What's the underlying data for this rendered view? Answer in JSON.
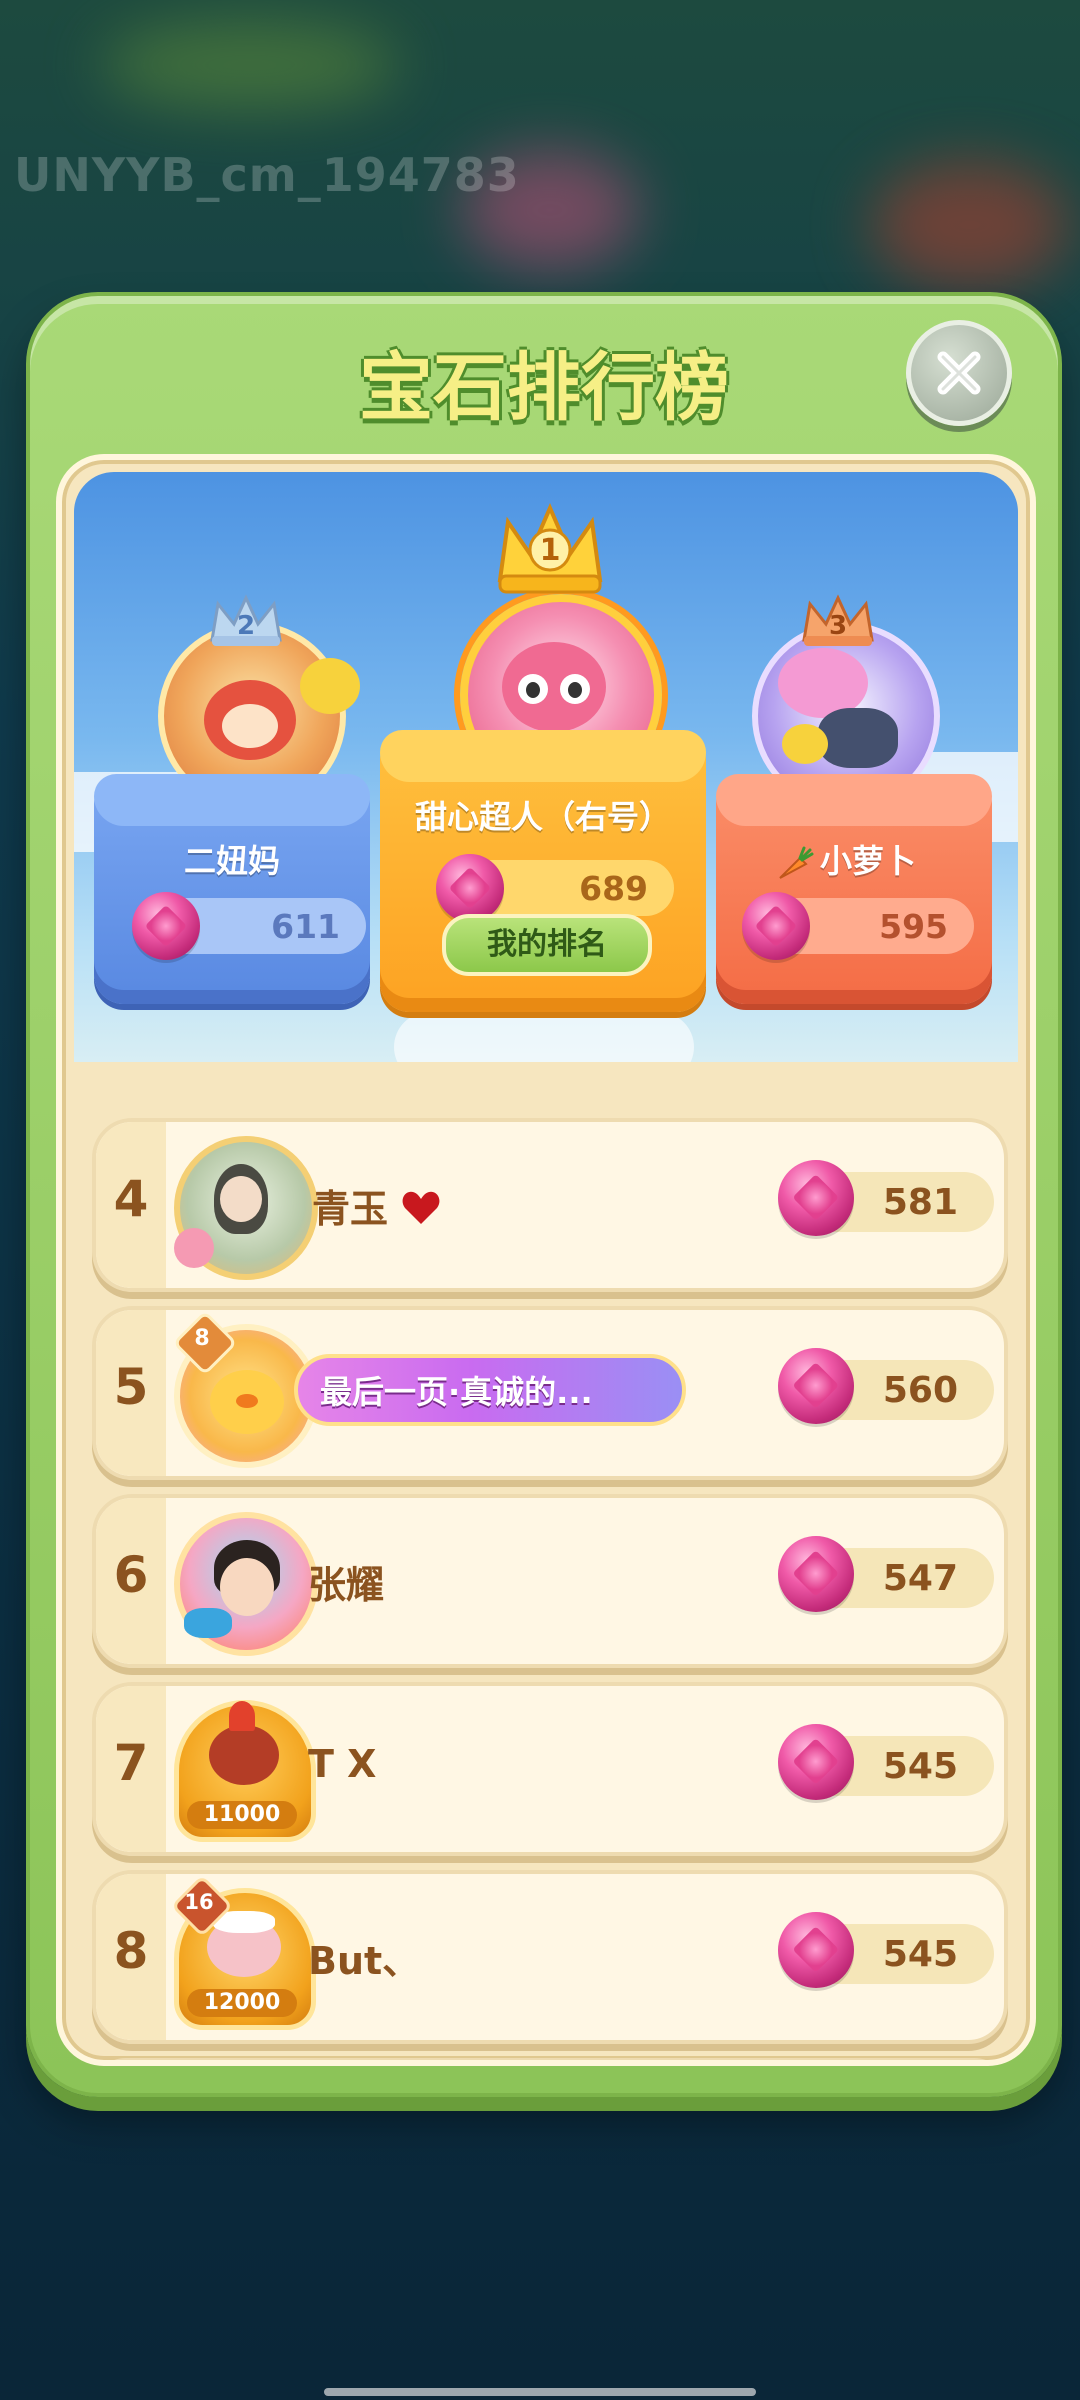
{
  "watermark": "UNYYB_cm_194783",
  "window": {
    "title": "宝石排行榜"
  },
  "podium": [
    {
      "rank": "1",
      "name": "甜心超人（右号）",
      "score": "689"
    },
    {
      "rank": "2",
      "name": "二妞妈",
      "score": "611"
    },
    {
      "rank": "3",
      "name": "小萝卜",
      "score": "595"
    }
  ],
  "my_rank_label": "我的排名",
  "rows": [
    {
      "rank": "4",
      "name": "青玉",
      "score": "581"
    },
    {
      "rank": "5",
      "name": "最后一页·真诚的...",
      "score": "560",
      "avatar_level": "8"
    },
    {
      "rank": "6",
      "name": "张耀",
      "score": "547"
    },
    {
      "rank": "7",
      "name": "T  X",
      "score": "545",
      "avatar_badge": "11000"
    },
    {
      "rank": "8",
      "name": "But、",
      "score": "545",
      "avatar_level": "16",
      "avatar_badge": "12000"
    }
  ],
  "colors": {
    "panel_green": "#8cc458",
    "title_yellow": "#f6ef86",
    "gem_pink": "#e2408f",
    "rank_brown": "#8b531f"
  }
}
